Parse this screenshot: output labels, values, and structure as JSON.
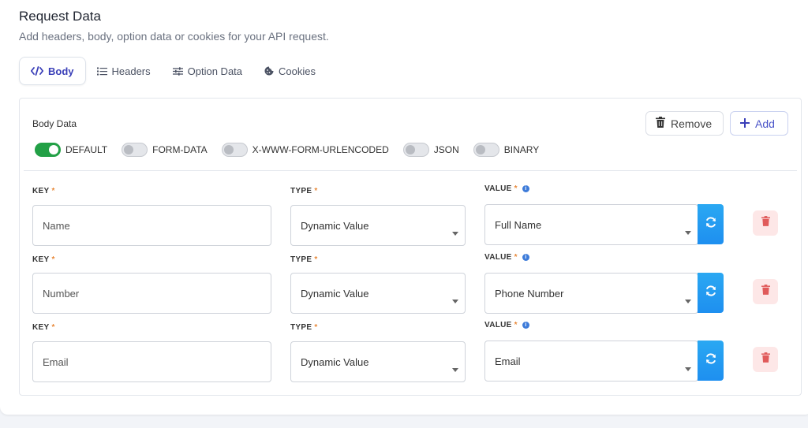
{
  "header": {
    "title": "Request Data",
    "subtitle": "Add headers, body, option data or cookies for your API request."
  },
  "tabs": [
    {
      "label": "Body",
      "icon": "code-icon",
      "active": true
    },
    {
      "label": "Headers",
      "icon": "list-icon",
      "active": false
    },
    {
      "label": "Option Data",
      "icon": "sliders-icon",
      "active": false
    },
    {
      "label": "Cookies",
      "icon": "cookie-icon",
      "active": false
    }
  ],
  "body_panel": {
    "label": "Body Data",
    "remove_label": "Remove",
    "add_label": "Add",
    "body_types": [
      {
        "label": "DEFAULT",
        "on": true
      },
      {
        "label": "FORM-DATA",
        "on": false
      },
      {
        "label": "X-WWW-FORM-URLENCODED",
        "on": false
      },
      {
        "label": "JSON",
        "on": false
      },
      {
        "label": "BINARY",
        "on": false
      }
    ],
    "key_label": "KEY",
    "type_label": "TYPE",
    "value_label": "VALUE",
    "required_mark": "*",
    "rows": [
      {
        "key": "Name",
        "type": "Dynamic Value",
        "value": "Full Name"
      },
      {
        "key": "Number",
        "type": "Dynamic Value",
        "value": "Phone Number"
      },
      {
        "key": "Email",
        "type": "Dynamic Value",
        "value": "Email"
      }
    ]
  },
  "colors": {
    "accent": "#3a3fb8",
    "toggle_on": "#22a046",
    "refresh_button": "#1e8ff0",
    "delete_bg": "#fde7e7",
    "delete_icon": "#e05a5a"
  }
}
